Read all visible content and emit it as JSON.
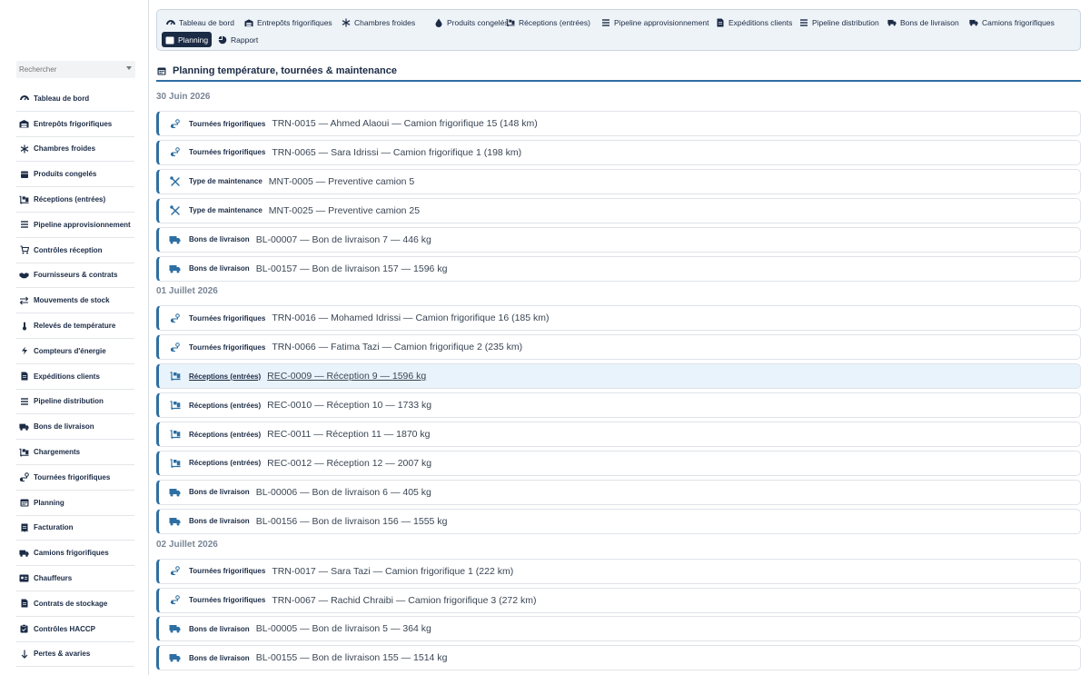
{
  "search": {
    "placeholder": "Rechercher"
  },
  "sidebar": {
    "items": [
      {
        "label": "Tableau de bord",
        "icon": "dashboard-icon"
      },
      {
        "label": "Entrepôts frigorifiques",
        "icon": "warehouse-icon"
      },
      {
        "label": "Chambres froides",
        "icon": "snowflake-icon"
      },
      {
        "label": "Produits congelés",
        "icon": "box-icon"
      },
      {
        "label": "Réceptions (entrées)",
        "icon": "dolly-icon"
      },
      {
        "label": "Pipeline approvisionnement",
        "icon": "bars-icon"
      },
      {
        "label": "Contrôles réception",
        "icon": "cart-check-icon"
      },
      {
        "label": "Fournisseurs & contrats",
        "icon": "handshake-icon"
      },
      {
        "label": "Mouvements de stock",
        "icon": "exchange-icon"
      },
      {
        "label": "Relevés de température",
        "icon": "thermometer-icon"
      },
      {
        "label": "Compteurs d'énergie",
        "icon": "bolt-icon"
      },
      {
        "label": "Expéditions clients",
        "icon": "document-icon"
      },
      {
        "label": "Pipeline distribution",
        "icon": "bars-icon"
      },
      {
        "label": "Bons de livraison",
        "icon": "truck-icon"
      },
      {
        "label": "Chargements",
        "icon": "dolly-icon"
      },
      {
        "label": "Tournées frigorifiques",
        "icon": "route-icon"
      },
      {
        "label": "Planning",
        "icon": "calendar-icon"
      },
      {
        "label": "Facturation",
        "icon": "invoice-icon"
      },
      {
        "label": "Camions frigorifiques",
        "icon": "truck-icon"
      },
      {
        "label": "Chauffeurs",
        "icon": "id-card-icon"
      },
      {
        "label": "Contrats de stockage",
        "icon": "document-icon"
      },
      {
        "label": "Contrôles HACCP",
        "icon": "clipboard-icon"
      },
      {
        "label": "Pertes & avaries",
        "icon": "arrow-down-icon"
      }
    ]
  },
  "tabs": [
    {
      "label": "Tableau de bord",
      "icon": "dashboard-icon"
    },
    {
      "label": "Entrepôts frigorifiques",
      "icon": "warehouse-icon"
    },
    {
      "label": "Chambres froides",
      "icon": "snowflake-icon"
    },
    {
      "label": "Produits congelés",
      "icon": "drop-icon"
    },
    {
      "label": "Réceptions (entrées)",
      "icon": "dolly-icon"
    },
    {
      "label": "Pipeline approvisionnement",
      "icon": "bars-icon"
    },
    {
      "label": "Expéditions clients",
      "icon": "document-icon"
    },
    {
      "label": "Pipeline distribution",
      "icon": "bars-icon"
    },
    {
      "label": "Bons de livraison",
      "icon": "truck-icon"
    },
    {
      "label": "Camions frigorifiques",
      "icon": "truck-icon"
    },
    {
      "label": "Planning",
      "icon": "calendar-icon",
      "active": true
    },
    {
      "label": "Rapport",
      "icon": "chart-pie-icon"
    }
  ],
  "main": {
    "title": "Planning température, tournées & maintenance",
    "days": [
      {
        "date": "30 Juin 2026",
        "events": [
          {
            "type": "Tournées frigorifiques",
            "text": "TRN-0015 — Ahmed Alaoui — Camion frigorifique 15 (148 km)",
            "icon": "route-icon"
          },
          {
            "type": "Tournées frigorifiques",
            "text": "TRN-0065 — Sara Idrissi — Camion frigorifique 1 (198 km)",
            "icon": "route-icon"
          },
          {
            "type": "Type de maintenance",
            "text": "MNT-0005 — Preventive camion 5",
            "icon": "tools-icon"
          },
          {
            "type": "Type de maintenance",
            "text": "MNT-0025 — Preventive camion 25",
            "icon": "tools-icon"
          },
          {
            "type": "Bons de livraison",
            "text": "BL-00007 — Bon de livraison 7 — 446 kg",
            "icon": "truck-icon"
          },
          {
            "type": "Bons de livraison",
            "text": "BL-00157 — Bon de livraison 157 — 1596 kg",
            "icon": "truck-icon"
          }
        ]
      },
      {
        "date": "01 Juillet 2026",
        "events": [
          {
            "type": "Tournées frigorifiques",
            "text": "TRN-0016 — Mohamed Idrissi — Camion frigorifique 16 (185 km)",
            "icon": "route-icon"
          },
          {
            "type": "Tournées frigorifiques",
            "text": "TRN-0066 — Fatima Tazi — Camion frigorifique 2 (235 km)",
            "icon": "route-icon"
          },
          {
            "type": "Réceptions (entrées)",
            "text": "REC-0009 — Réception 9 — 1596 kg",
            "icon": "dolly-icon",
            "highlight": true
          },
          {
            "type": "Réceptions (entrées)",
            "text": "REC-0010 — Réception 10 — 1733 kg",
            "icon": "dolly-icon"
          },
          {
            "type": "Réceptions (entrées)",
            "text": "REC-0011 — Réception 11 — 1870 kg",
            "icon": "dolly-icon"
          },
          {
            "type": "Réceptions (entrées)",
            "text": "REC-0012 — Réception 12 — 2007 kg",
            "icon": "dolly-icon"
          },
          {
            "type": "Bons de livraison",
            "text": "BL-00006 — Bon de livraison 6 — 405 kg",
            "icon": "truck-icon"
          },
          {
            "type": "Bons de livraison",
            "text": "BL-00156 — Bon de livraison 156 — 1555 kg",
            "icon": "truck-icon"
          }
        ]
      },
      {
        "date": "02 Juillet 2026",
        "events": [
          {
            "type": "Tournées frigorifiques",
            "text": "TRN-0017 — Sara Tazi — Camion frigorifique 1 (222 km)",
            "icon": "route-icon"
          },
          {
            "type": "Tournées frigorifiques",
            "text": "TRN-0067 — Rachid Chraibi — Camion frigorifique 3 (272 km)",
            "icon": "route-icon"
          },
          {
            "type": "Bons de livraison",
            "text": "BL-00005 — Bon de livraison 5 — 364 kg",
            "icon": "truck-icon"
          },
          {
            "type": "Bons de livraison",
            "text": "BL-00155 — Bon de livraison 155 — 1514 kg",
            "icon": "truck-icon"
          }
        ]
      }
    ]
  },
  "colors": {
    "accent": "#2e6fa3",
    "navy": "#1b2b45",
    "muted": "#7a8696",
    "highlight": "#e9f3fb"
  }
}
